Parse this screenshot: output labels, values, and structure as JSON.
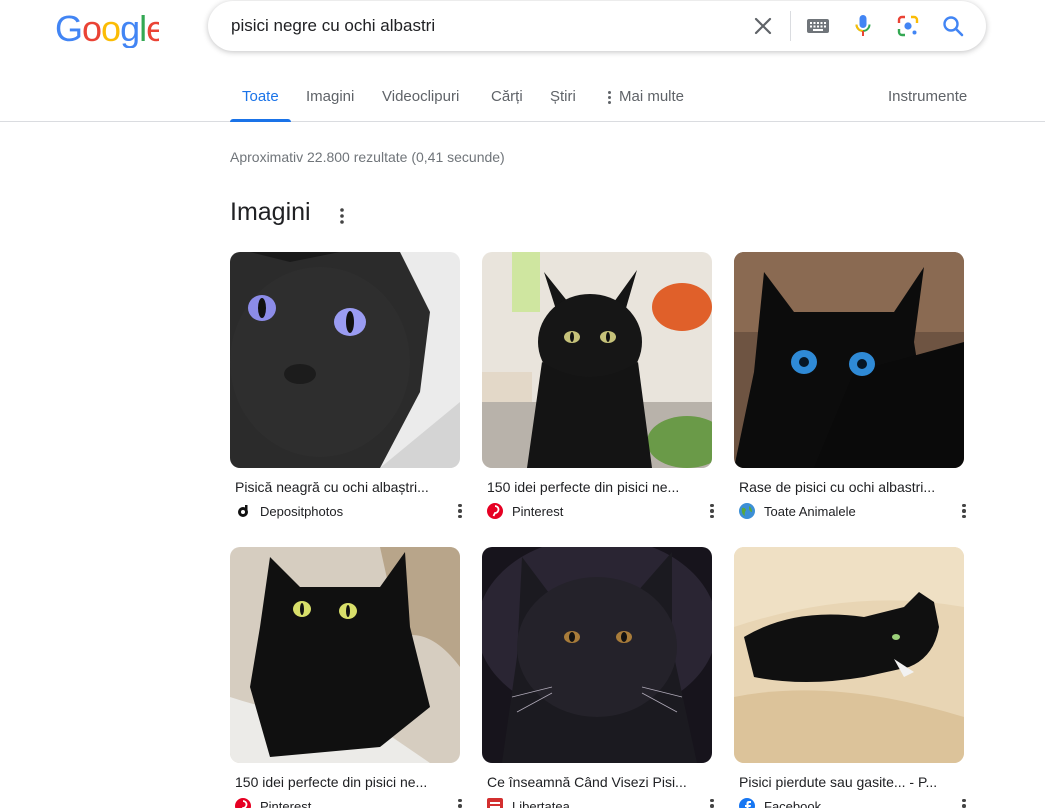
{
  "logo": {
    "text": "Google"
  },
  "search": {
    "query": "pisici negre cu ochi albastri"
  },
  "icons": {
    "clear": "close-icon",
    "keyboard": "keyboard-icon",
    "voice": "microphone-icon",
    "lens": "camera-lens-icon",
    "search": "search-icon"
  },
  "tabs": [
    {
      "label": "Toate",
      "active": true
    },
    {
      "label": "Imagini"
    },
    {
      "label": "Videoclipuri"
    },
    {
      "label": "Cărți"
    },
    {
      "label": "Știri"
    },
    {
      "label": "Mai multe"
    }
  ],
  "tools_label": "Instrumente",
  "result_stats": "Aproximativ 22.800 rezultate (0,41 secunde)",
  "images_section": {
    "title": "Imagini",
    "items": [
      {
        "caption": "Pisică neagră cu ochi albaștri...",
        "source": "Depositphotos",
        "source_icon": "depositphotos-icon"
      },
      {
        "caption": "150 idei perfecte din pisici ne...",
        "source": "Pinterest",
        "source_icon": "pinterest-icon"
      },
      {
        "caption": "Rase de pisici cu ochi albastri...",
        "source": "Toate Animalele",
        "source_icon": "globe-icon"
      },
      {
        "caption": "150 idei perfecte din pisici ne...",
        "source": "Pinterest",
        "source_icon": "pinterest-icon"
      },
      {
        "caption": "Ce înseamnă Când Visezi Pisi...",
        "source": "Libertatea",
        "source_icon": "libertatea-icon"
      },
      {
        "caption": "Pisici pierdute sau gasite... - P...",
        "source": "Facebook",
        "source_icon": "facebook-icon"
      }
    ]
  },
  "colors": {
    "accent": "#1a73e8",
    "google_blue": "#4285f4",
    "google_red": "#ea4335",
    "google_yellow": "#fbbc05",
    "google_green": "#34a853"
  }
}
